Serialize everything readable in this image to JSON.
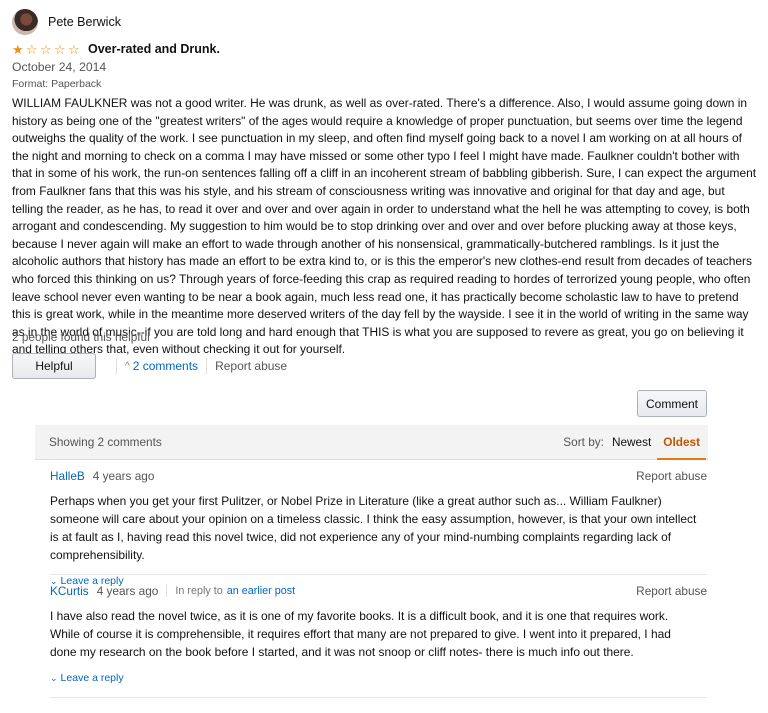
{
  "review": {
    "reviewer_name": "Pete Berwick",
    "rating": 1,
    "max_rating": 5,
    "title": "Over-rated and Drunk.",
    "date": "October 24, 2014",
    "format": "Format: Paperback",
    "body": "WILLIAM FAULKNER was not a good writer. He was drunk, as well as over-rated. There's a difference. Also, I would assume going down in history as being one of the \"greatest writers\" of the ages would require a knowledge of proper punctuation, but seems over time the legend outweighs the quality of the work. I see punctuation in my sleep, and often find myself going back to a novel I am working on at all hours of the night and morning to check on a comma I may have missed or some other typo I feel I might have made. Faulkner couldn't bother with that in some of his work, the run-on sentences falling off a cliff in an incoherent stream of babbling gibberish. Sure, I can expect the argument from Faulkner fans that this was his style, and his stream of consciousness writing was innovative and original for that day and age, but telling the reader, as he has, to read it over and over and over again in order to understand what the hell he was attempting to covey, is both arrogant and condescending. My suggestion to him would be to stop drinking over and over and over before plucking away at those keys, because I never again will make an effort to wade through another of his nonsensical, grammatically-butchered ramblings. Is it just the alcoholic authors that history has made an effort to be extra kind to, or is this the emperor's new clothes-end result from decades of teachers who forced this thinking on us? Through years of force-feeding this crap as required reading to hordes of terrorized young people, who often leave school never even wanting to be near a book again, much less read one, it has practically become scholastic law to have to pretend this is great work, while in the meantime more deserved writers of the day fell by the wayside. I see it in the world of writing in the same way as in the world of music--if you are told long and hard enough that THIS is what you are supposed to revere as great, you go on believing it and telling others that, even without checking it out for yourself.",
    "helpful_count": "2 people found this helpful"
  },
  "actions": {
    "helpful_label": "Helpful",
    "comments_link": "2 comments",
    "report_abuse": "Report abuse",
    "comment_button": "Comment"
  },
  "comments_section": {
    "showing": "Showing 2 comments",
    "sort_label": "Sort by:",
    "sort_newest": "Newest",
    "sort_oldest": "Oldest",
    "active_sort": "Oldest",
    "comments": [
      {
        "author": "HalleB",
        "time": "4 years ago",
        "report": "Report abuse",
        "text": "Perhaps when you get your first Pulitzer, or Nobel Prize in Literature (like a great author such as... William Faulkner) someone will care about your opinion on a timeless classic. I think the easy assumption, however, is that your own intellect is at fault as I, having read this novel twice, did not experience any of your mind-numbing complaints regarding lack of comprehensibility.",
        "reply": "Leave a reply"
      },
      {
        "author": "KCurtis",
        "time": "4 years ago",
        "in_reply_to": "In reply to",
        "in_reply_link": "an earlier post",
        "report": "Report abuse",
        "text": "I have also read the novel twice, as it is one of my favorite books. It is a difficult book, and it is one that requires work. While of course it is comprehensible, it requires effort that many are not prepared to give. I went into it prepared, I had done my research on the book before I started, and it was not snoop or cliff notes- there is much info out there.",
        "reply": "Leave a reply"
      }
    ]
  },
  "colors": {
    "link": "#0066c0",
    "star": "#e8901a",
    "active_sort": "#c45500"
  },
  "icons": {
    "avatar": "avatar",
    "star_filled": "star-filled-icon",
    "star_empty": "star-empty-icon",
    "chevron_up": "chevron-up-icon",
    "chevron_down": "chevron-down-icon"
  }
}
